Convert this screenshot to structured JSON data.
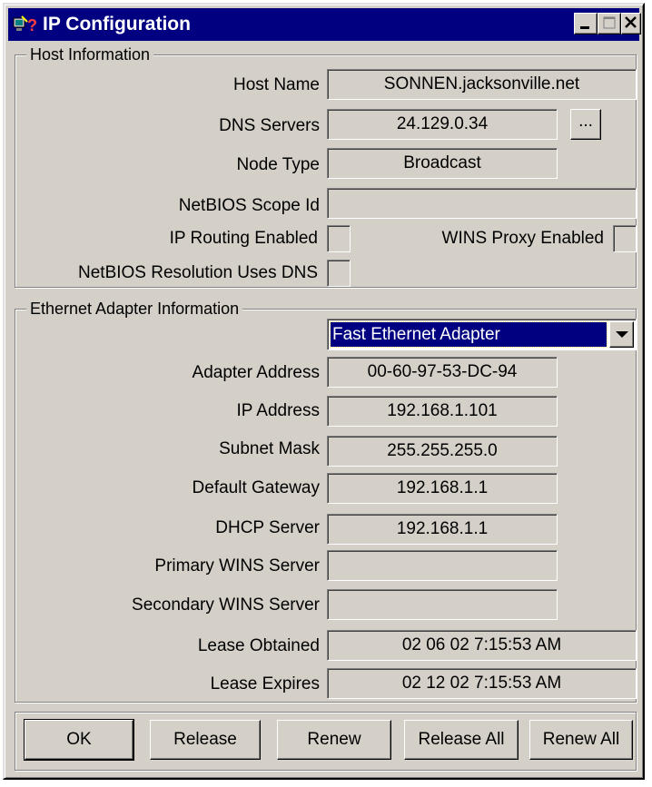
{
  "window": {
    "title": "IP Configuration"
  },
  "host_info": {
    "legend": "Host Information",
    "host_name_label": "Host Name",
    "host_name": "SONNEN.jacksonville.net",
    "dns_servers_label": "DNS Servers",
    "dns_servers": "24.129.0.34",
    "dns_more_label": "...",
    "node_type_label": "Node Type",
    "node_type": "Broadcast",
    "netbios_scope_label": "NetBIOS Scope Id",
    "netbios_scope": "",
    "ip_routing_label": "IP Routing Enabled",
    "ip_routing_checked": false,
    "wins_proxy_label": "WINS Proxy Enabled",
    "wins_proxy_checked": false,
    "netbios_dns_label": "NetBIOS Resolution Uses DNS",
    "netbios_dns_checked": false
  },
  "adapter_info": {
    "legend": "Ethernet  Adapter Information",
    "selected_adapter": "Fast Ethernet Adapter",
    "adapter_address_label": "Adapter Address",
    "adapter_address": "00-60-97-53-DC-94",
    "ip_address_label": "IP Address",
    "ip_address": "192.168.1.101",
    "subnet_mask_label": "Subnet Mask",
    "subnet_mask": "255.255.255.0",
    "default_gateway_label": "Default Gateway",
    "default_gateway": "192.168.1.1",
    "dhcp_server_label": "DHCP Server",
    "dhcp_server": "192.168.1.1",
    "primary_wins_label": "Primary WINS Server",
    "primary_wins": "",
    "secondary_wins_label": "Secondary WINS Server",
    "secondary_wins": "",
    "lease_obtained_label": "Lease Obtained",
    "lease_obtained": "02 06 02 7:15:53 AM",
    "lease_expires_label": "Lease Expires",
    "lease_expires": "02 12 02 7:15:53 AM"
  },
  "buttons": {
    "ok": "OK",
    "release": "Release",
    "renew": "Renew",
    "release_all": "Release All",
    "renew_all": "Renew All"
  },
  "colors": {
    "titlebar": "#000080",
    "face": "#d4d0c8",
    "selection": "#000080"
  },
  "icons": {
    "app": "network-config-icon",
    "minimize": "minimize-icon",
    "maximize": "maximize-icon",
    "close": "close-icon",
    "dropdown": "chevron-down-icon"
  }
}
